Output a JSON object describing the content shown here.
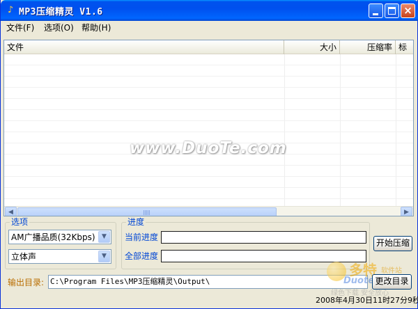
{
  "window": {
    "title": "MP3压缩精灵 V1.6",
    "app_icon": "music-note-icon"
  },
  "titlebar_buttons": [
    "minimize-icon",
    "maximize-icon",
    "close-icon"
  ],
  "menu": [
    {
      "label": "文件(F)"
    },
    {
      "label": "选项(O)"
    },
    {
      "label": "帮助(H)"
    }
  ],
  "file_list": {
    "columns": [
      "文件",
      "大小",
      "压缩率",
      "标"
    ],
    "rows": []
  },
  "watermark": "www.DuoTe.com",
  "options": {
    "title": "选项",
    "quality_selected": "AM广播品质(32Kbps)",
    "channel_selected": "立体声"
  },
  "progress": {
    "title": "进度",
    "current_label": "当前进度",
    "total_label": "全部进度",
    "current_value": 0,
    "total_value": 0
  },
  "buttons": {
    "start": "开始压缩",
    "change_dir": "更改目录"
  },
  "output": {
    "label": "输出目录:",
    "path": "C:\\Program Files\\MP3压缩精灵\\Output\\"
  },
  "logo": {
    "cn": "多特",
    "cn_small": "软件站",
    "en": "Duote",
    "sub": "绿色下载 安全放心"
  },
  "status": {
    "datetime": "2008年4月30日11时27分9秒"
  },
  "colors": {
    "titlebar": "#0053ee",
    "group_label": "#0046d5",
    "output_label": "#b96d00"
  }
}
